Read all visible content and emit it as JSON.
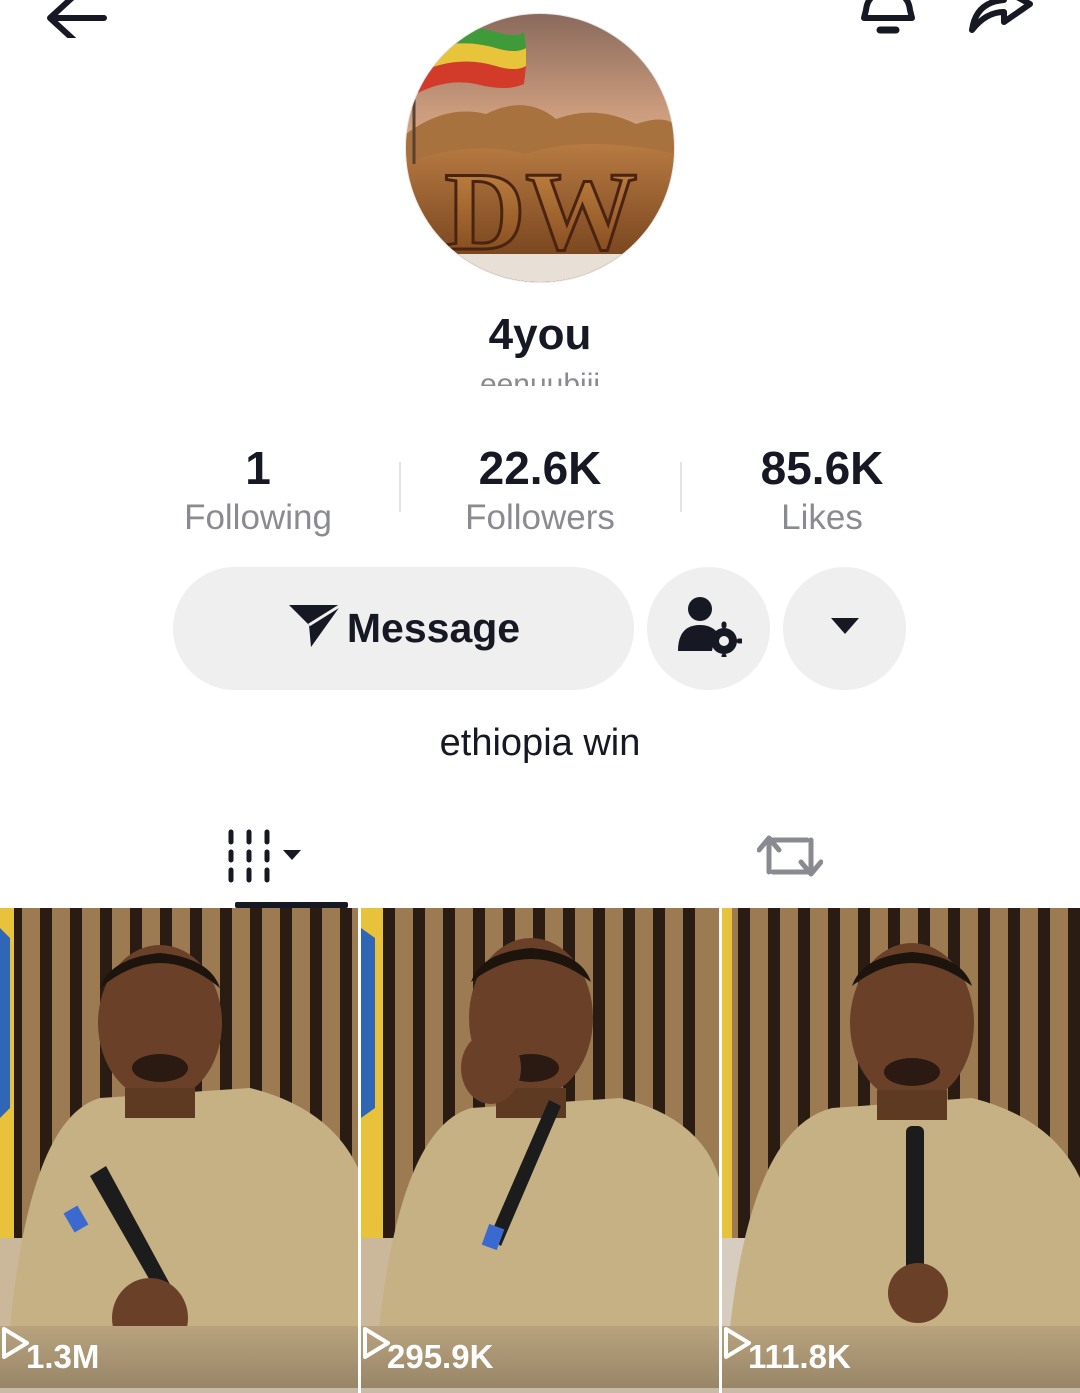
{
  "profile": {
    "name": "4you",
    "handle": "eenuubiii",
    "bio": "ethiopia win",
    "avatar_text": "DW"
  },
  "stats": [
    {
      "value": "1",
      "label": "Following"
    },
    {
      "value": "22.6K",
      "label": "Followers"
    },
    {
      "value": "85.6K",
      "label": "Likes"
    }
  ],
  "actions": {
    "message_label": "Message"
  },
  "icons": {
    "back": "arrow-left-icon",
    "bell": "bell-icon",
    "share": "share-arrow-icon",
    "message": "paper-plane-icon",
    "friends": "person-gear-icon",
    "more": "caret-down-icon",
    "videos_tab": "grid-sort-icon",
    "reposts_tab": "repost-icon",
    "play": "play-outline-icon"
  },
  "videos": [
    {
      "views": "1.3M"
    },
    {
      "views": "295.9K"
    },
    {
      "views": "111.8K"
    }
  ],
  "colors": {
    "text": "#161823",
    "secondary": "#8a8b91",
    "button_bg": "#efefef"
  }
}
